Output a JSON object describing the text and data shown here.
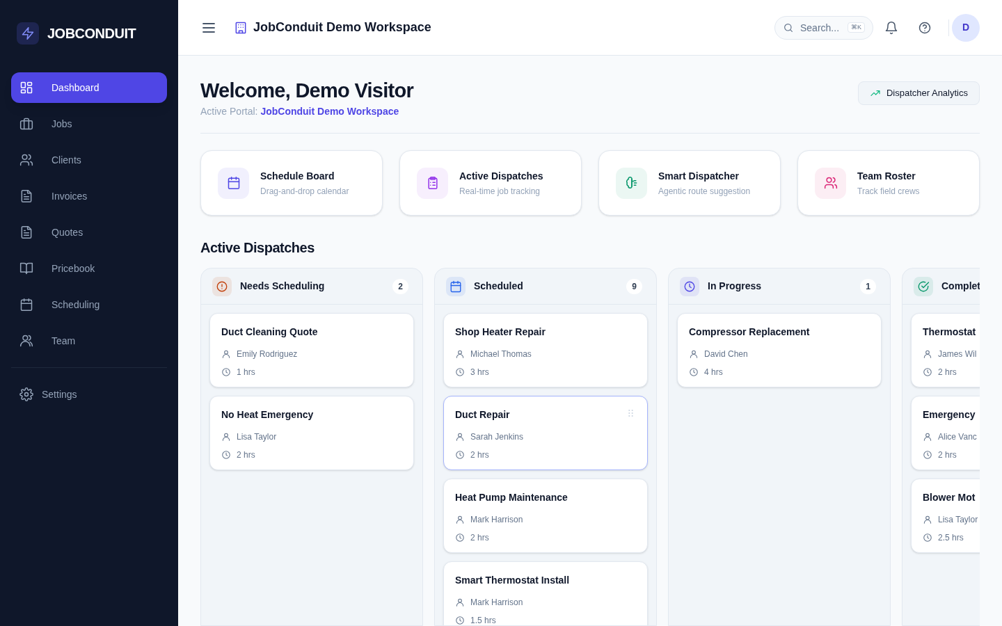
{
  "brand": {
    "name": "JOBCONDUIT"
  },
  "sidebar": {
    "items": [
      {
        "label": "Dashboard",
        "selected": true
      },
      {
        "label": "Jobs",
        "selected": false
      },
      {
        "label": "Clients",
        "selected": false
      },
      {
        "label": "Invoices",
        "selected": false
      },
      {
        "label": "Quotes",
        "selected": false
      },
      {
        "label": "Pricebook",
        "selected": false
      },
      {
        "label": "Scheduling",
        "selected": false
      },
      {
        "label": "Team",
        "selected": false
      }
    ],
    "footer_items": [
      {
        "label": "Settings",
        "selected": false
      }
    ]
  },
  "topbar": {
    "workspace": "JobConduit Demo Workspace",
    "search": {
      "placeholder": "Search...",
      "shortcut": "⌘K"
    },
    "avatar": "D"
  },
  "header": {
    "title": "Welcome, Demo Visitor",
    "portal_label": "Active Portal:",
    "portal_name": "JobConduit Demo Workspace",
    "action": "Dispatcher Analytics"
  },
  "quick_links": [
    {
      "title": "Schedule Board",
      "subtitle": "Drag-and-drop calendar"
    },
    {
      "title": "Active Dispatches",
      "subtitle": "Real-time job tracking"
    },
    {
      "title": "Smart Dispatcher",
      "subtitle": "Agentic route suggestion"
    },
    {
      "title": "Team Roster",
      "subtitle": "Track field crews"
    }
  ],
  "board": {
    "title": "Active Dispatches",
    "columns": [
      {
        "name": "Needs Scheduling",
        "count": "2",
        "cards": [
          {
            "title": "Duct Cleaning Quote",
            "client": "Emily Rodriguez",
            "duration": "1 hrs",
            "highlighted": false
          },
          {
            "title": "No Heat Emergency",
            "client": "Lisa Taylor",
            "duration": "2 hrs",
            "highlighted": false
          }
        ]
      },
      {
        "name": "Scheduled",
        "count": "9",
        "cards": [
          {
            "title": "Shop Heater Repair",
            "client": "Michael Thomas",
            "duration": "3 hrs",
            "highlighted": false
          },
          {
            "title": "Duct Repair",
            "client": "Sarah Jenkins",
            "duration": "2 hrs",
            "highlighted": true
          },
          {
            "title": "Heat Pump Maintenance",
            "client": "Mark Harrison",
            "duration": "2 hrs",
            "highlighted": false
          },
          {
            "title": "Smart Thermostat Install",
            "client": "Mark Harrison",
            "duration": "1.5 hrs",
            "highlighted": false
          }
        ]
      },
      {
        "name": "In Progress",
        "count": "1",
        "cards": [
          {
            "title": "Compressor Replacement",
            "client": "David Chen",
            "duration": "4 hrs",
            "highlighted": false
          }
        ]
      },
      {
        "name": "Complet",
        "cards": [
          {
            "title": "Thermostat",
            "client": "James Wil",
            "duration": "2 hrs",
            "highlighted": false
          },
          {
            "title": "Emergency",
            "client": "Alice Vanc",
            "duration": "2 hrs",
            "highlighted": false
          },
          {
            "title": "Blower Mot",
            "client": "Lisa Taylor",
            "duration": "2.5 hrs",
            "highlighted": false
          }
        ]
      }
    ]
  }
}
